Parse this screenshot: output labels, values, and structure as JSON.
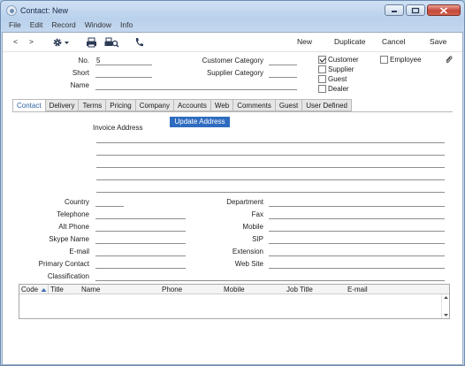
{
  "window": {
    "title": "Contact: New"
  },
  "menu": [
    "File",
    "Edit",
    "Record",
    "Window",
    "Info"
  ],
  "toolbar": {
    "prev": "<",
    "next": ">",
    "settings_icon": "gear-icon",
    "print_icon": "printer-icon",
    "preview_icon": "print-preview-icon",
    "phone_icon": "phone-icon",
    "new": "New",
    "duplicate": "Duplicate",
    "cancel": "Cancel",
    "save": "Save"
  },
  "header": {
    "no_label": "No.",
    "no_value": "5",
    "short_label": "Short",
    "short_value": "",
    "name_label": "Name",
    "name_value": "",
    "customer_category_label": "Customer Category",
    "customer_category_value": "",
    "supplier_category_label": "Supplier Category",
    "supplier_category_value": "",
    "checkboxes": {
      "customer": {
        "label": "Customer",
        "checked": true
      },
      "supplier": {
        "label": "Supplier",
        "checked": false
      },
      "guest": {
        "label": "Guest",
        "checked": false
      },
      "dealer": {
        "label": "Dealer",
        "checked": false
      },
      "employee": {
        "label": "Employee",
        "checked": false
      }
    },
    "attach_icon": "paperclip-icon"
  },
  "tabs": [
    "Contact",
    "Delivery",
    "Terms",
    "Pricing",
    "Company",
    "Accounts",
    "Web",
    "Comments",
    "Guest",
    "User Defined"
  ],
  "active_tab": "Contact",
  "contact": {
    "update_address": "Update Address",
    "invoice_address_label": "Invoice Address",
    "country_label": "Country",
    "telephone_label": "Telephone",
    "alt_phone_label": "Alt Phone",
    "skype_label": "Skype Name",
    "email_label": "E-mail",
    "primary_contact_label": "Primary Contact",
    "classification_label": "Classification",
    "department_label": "Department",
    "fax_label": "Fax",
    "mobile_label": "Mobile",
    "sip_label": "SIP",
    "extension_label": "Extension",
    "website_label": "Web Site"
  },
  "grid": {
    "columns": [
      "Code",
      "Title",
      "Name",
      "Phone",
      "Mobile",
      "Job Title",
      "E-mail"
    ],
    "sort_icon": "sort-ascending-icon"
  }
}
